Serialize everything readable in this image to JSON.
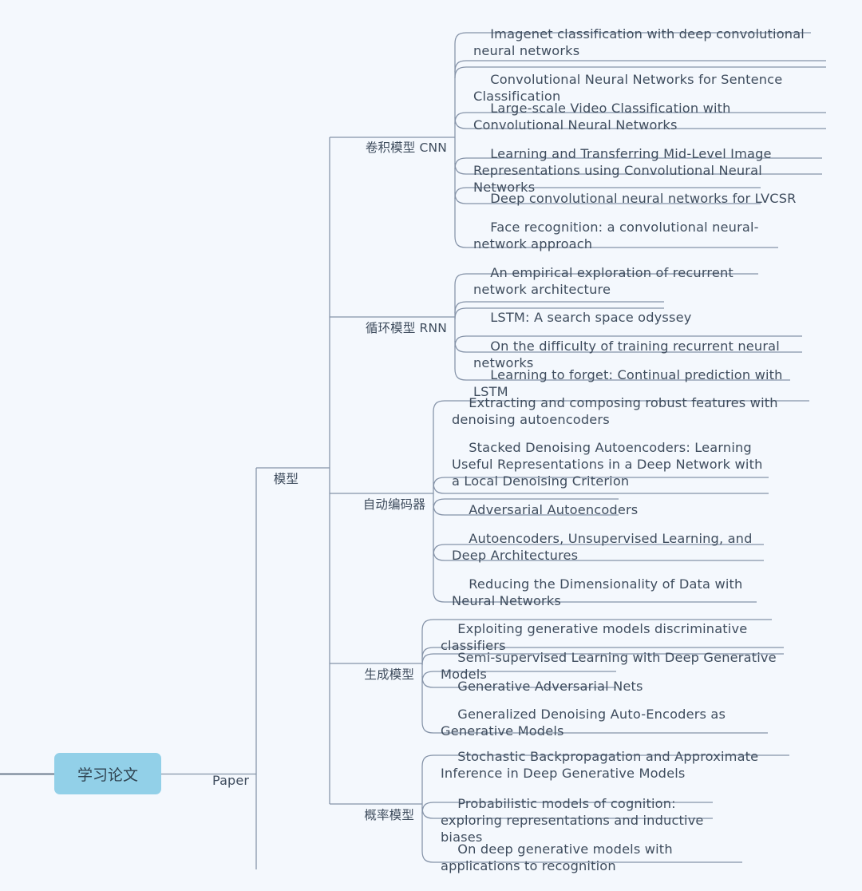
{
  "canvas": {
    "background": "#f4f8fd",
    "wire_color": "#8593a8",
    "text_color": "#3f4d5e",
    "root_fill": "#92d0e8"
  },
  "root": {
    "label": "学习论文"
  },
  "branch": {
    "label": "Paper"
  },
  "level2": {
    "label": "模型"
  },
  "categories": [
    {
      "id": "cnn",
      "label": "卷积模型 CNN",
      "papers": [
        "Imagenet classification with deep convolutional neural networks",
        "Convolutional Neural Networks for Sentence Classification",
        "Large-scale Video Classification with Convolutional Neural Networks",
        "Learning and Transferring Mid-Level Image Representations using Convolutional Neural Networks",
        "Deep convolutional neural networks for LVCSR",
        "Face recognition: a convolutional neural-network approach"
      ]
    },
    {
      "id": "rnn",
      "label": "循环模型 RNN",
      "papers": [
        "An empirical exploration of recurrent network architecture",
        "LSTM: A search space odyssey",
        "On the difficulty of training recurrent neural networks",
        "Learning to forget: Continual prediction with LSTM"
      ]
    },
    {
      "id": "autoencoder",
      "label": "自动编码器",
      "papers": [
        "Extracting and composing robust features with denoising autoencoders",
        "Stacked Denoising Autoencoders: Learning Useful Representations in a Deep Network with a Local Denoising Criterion",
        "Adversarial Autoencoders",
        "Autoencoders, Unsupervised Learning, and Deep Architectures",
        "Reducing the Dimensionality of Data with Neural Networks"
      ]
    },
    {
      "id": "generative",
      "label": "生成模型",
      "papers": [
        "Exploiting generative models discriminative classifiers",
        "Semi-supervised Learning with Deep Generative Models",
        "Generative Adversarial Nets",
        "Generalized Denoising Auto-Encoders as Generative Models"
      ]
    },
    {
      "id": "probabilistic",
      "label": "概率模型",
      "papers": [
        "Stochastic Backpropagation and Approximate Inference in Deep Generative Models",
        "Probabilistic models of cognition: exploring representations and inductive biases",
        "On deep generative models with applications to recognition"
      ]
    }
  ]
}
